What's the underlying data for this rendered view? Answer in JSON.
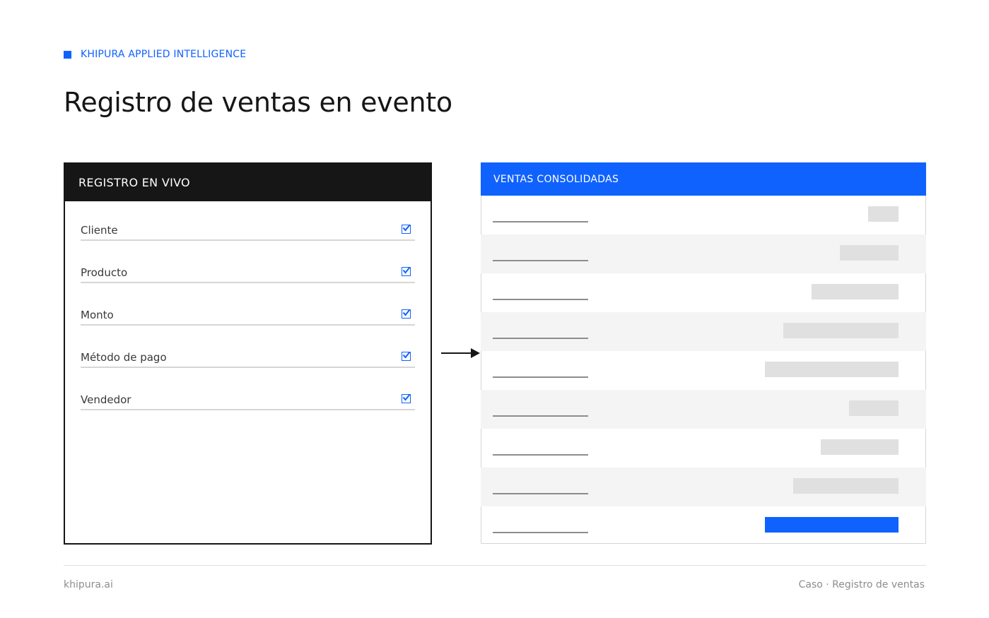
{
  "brand": {
    "eyebrow": "KHIPURA APPLIED INTELLIGENCE",
    "accent_color": "#0f62fe",
    "dark_color": "#161616"
  },
  "title": "Registro de ventas en evento",
  "left_panel": {
    "header": "REGISTRO EN VIVO",
    "fields": [
      {
        "label": "Cliente",
        "checked": true,
        "icon": "checkbox-checked-icon"
      },
      {
        "label": "Producto",
        "checked": true,
        "icon": "checkbox-checked-icon"
      },
      {
        "label": "Monto",
        "checked": true,
        "icon": "checkbox-checked-icon"
      },
      {
        "label": "Método de pago",
        "checked": true,
        "icon": "checkbox-checked-icon"
      },
      {
        "label": "Vendedor",
        "checked": true,
        "icon": "checkbox-checked-icon"
      }
    ]
  },
  "connector": {
    "icon": "arrow-right-icon"
  },
  "right_panel": {
    "header": "VENTAS CONSOLIDADAS",
    "rows": [
      {
        "amount_level": 0.23,
        "highlight": false
      },
      {
        "amount_level": 0.44,
        "highlight": false
      },
      {
        "amount_level": 0.65,
        "highlight": false
      },
      {
        "amount_level": 0.86,
        "highlight": false
      },
      {
        "amount_level": 1.0,
        "highlight": false
      },
      {
        "amount_level": 0.37,
        "highlight": false
      },
      {
        "amount_level": 0.58,
        "highlight": false
      },
      {
        "amount_level": 0.79,
        "highlight": false
      },
      {
        "amount_level": 1.0,
        "highlight": true
      }
    ]
  },
  "footer": {
    "left": "khipura.ai",
    "right": "Caso · Registro de ventas"
  }
}
